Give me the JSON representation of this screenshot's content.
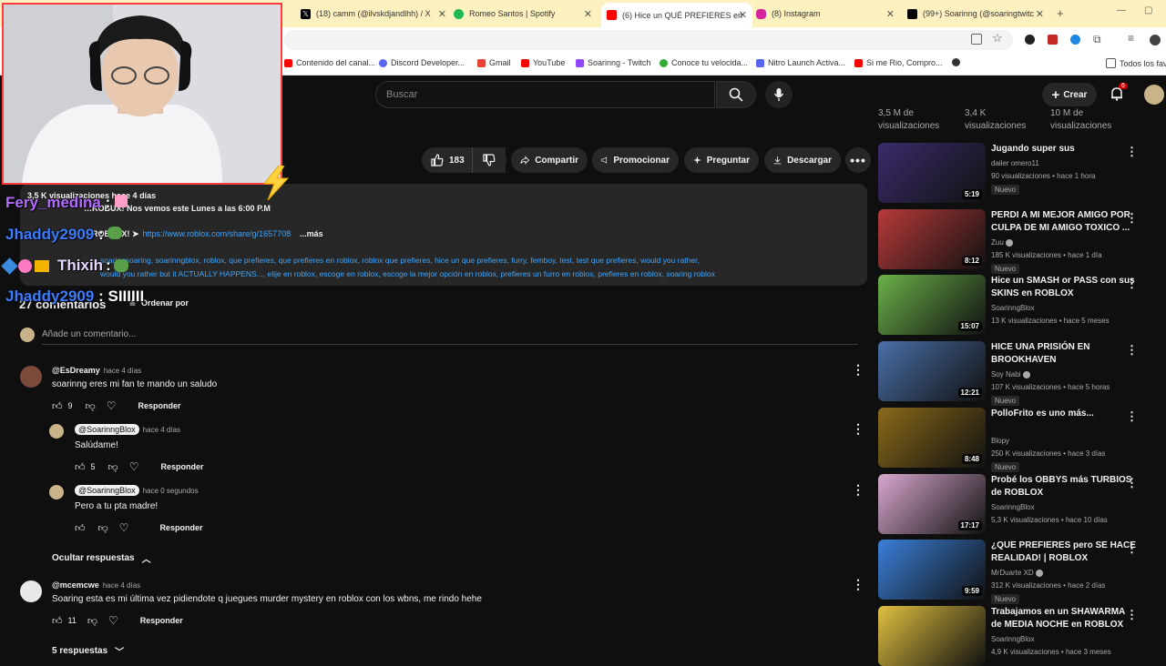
{
  "browser": {
    "tabs": [
      {
        "label": "(18) camm (@ilvskdjandlhh) / X",
        "color": "#000000",
        "icon": "x-logo-icon"
      },
      {
        "label": "Romeo Santos | Spotify",
        "color": "#1db954",
        "icon": "spotify-icon"
      },
      {
        "label": "(6) Hice un QUÉ PREFIERES en",
        "color": "#ff0000",
        "icon": "youtube-icon"
      },
      {
        "label": "(8) Instagram",
        "color": "#d6249f",
        "icon": "instagram-icon"
      },
      {
        "label": "(99+) Soarinng (@soaringtwitc",
        "color": "#000000",
        "icon": "tiktok-icon"
      }
    ],
    "bookmarks": [
      {
        "label": "Contenido del canal...",
        "color": "#ff0000"
      },
      {
        "label": "Discord Developer...",
        "color": "#5865f2"
      },
      {
        "label": "Gmail",
        "color": "#ea4335"
      },
      {
        "label": "YouTube",
        "color": "#ff0000"
      },
      {
        "label": "Soarinng - Twitch",
        "color": "#9146ff"
      },
      {
        "label": "Conoce tu velocida...",
        "color": "#33aa33"
      },
      {
        "label": "Nitro Launch Activa...",
        "color": "#5865f2"
      },
      {
        "label": "Si me Rio, Compro...",
        "color": "#ff0000"
      }
    ],
    "all_bookmarks": "Todos los fav"
  },
  "youtube": {
    "search_placeholder": "Buscar",
    "create_label": "Crear",
    "notif_count": "6",
    "top_stats": [
      "3,5 M de visualizaciones",
      "3,4 K visualizaciones",
      "10 M de visualizaciones"
    ],
    "actions": {
      "likes": "183",
      "share": "Compartir",
      "promote": "Promocionar",
      "ask": "Preguntar",
      "download": "Descargar"
    },
    "description": {
      "stats": "3,5 K visualizaciones  hace 4 días",
      "line1": "…ROBUX! Nos vemos este Lunes a las 6:00 P.M",
      "line2_prefix": "…ROBLOX! ➤",
      "link": "https://www.roblox.com/share/g/1657708",
      "more": "...más",
      "tags_line1": "soaringsoaring, soarinngblox, roblox, que prefieres, que prefieres en roblox, roblox que prefieres, hice un que prefieres, furry, femboy, test, test que prefieres, would you rather,",
      "tags_line2": "would you rather but it ACTUALLY HAPPENS..., elije en roblox, escoge en roblox, escoge la mejor opción en roblox, prefieres un furro en roblox, prefieres en roblox, soaring roblox"
    },
    "comments_header": {
      "count": "27 comentarios",
      "sort": "Ordenar por"
    },
    "add_comment": "Añade un comentario...",
    "comments": [
      {
        "author": "@EsDreamy",
        "time": "hace 4 días",
        "text": "soarinng eres mi fan te mando un saludo",
        "likes": "9",
        "reply": "Responder"
      },
      {
        "author": "@SoarinngBlox",
        "time": "hace 4 días",
        "text": "Salúdame!",
        "likes": "5",
        "reply": "Responder"
      },
      {
        "author": "@SoarinngBlox",
        "time": "hace 0 segundos",
        "text": "Pero a tu pta madre!",
        "likes": "",
        "reply": "Responder"
      },
      {
        "author": "@mcemcwe",
        "time": "hace 4 días",
        "text": "Soaring esta es mi última vez pidiendote q juegues murder mystery en roblox con los wbns, me rindo hehe",
        "likes": "11",
        "reply": "Responder"
      }
    ],
    "hide_replies": "Ocultar respuestas",
    "more_replies": "5 respuestas",
    "recommendations": [
      {
        "title": "Jugando super sus",
        "channel": "dailer omero11",
        "meta": "90 visualizaciones • hace 1 hora",
        "badge": "Nuevo",
        "duration": "5:19",
        "thumb": "#3b2b6b",
        "verified": false
      },
      {
        "title": "PERDI A MI MEJOR AMIGO POR CULPA DE MI AMIGO TOXICO ...",
        "channel": "Zuu",
        "meta": "185 K visualizaciones • hace 1 día",
        "badge": "Nuevo",
        "duration": "8:12",
        "thumb": "#b83a3a",
        "verified": true
      },
      {
        "title": "Hice un SMASH or PASS con sus SKINS en ROBLOX",
        "channel": "SoarinngBlox",
        "meta": "13 K visualizaciones • hace 5 meses",
        "badge": "",
        "duration": "15:07",
        "thumb": "#6bb04a",
        "verified": false
      },
      {
        "title": "HICE UNA PRISIÓN EN BROOKHAVEN",
        "channel": "Soy Nabi",
        "meta": "107 K visualizaciones • hace 5 horas",
        "badge": "Nuevo",
        "duration": "12:21",
        "thumb": "#4a6fa8",
        "verified": true
      },
      {
        "title": "PolloFrito es uno más...",
        "channel": "Blopy",
        "meta": "250 K visualizaciones • hace 3 días",
        "badge": "Nuevo",
        "duration": "8:48",
        "thumb": "#8a6a1a",
        "verified": false
      },
      {
        "title": "Probé los OBBYS más TURBIOS de ROBLOX",
        "channel": "SoarinngBlox",
        "meta": "5,3 K visualizaciones • hace 10 días",
        "badge": "",
        "duration": "17:17",
        "thumb": "#d9a8d0",
        "verified": false
      },
      {
        "title": "¿QUE PREFIERES pero SE HACE REALIDAD! | ROBLOX",
        "channel": "MrDuarte XD",
        "meta": "312 K visualizaciones • hace 2 días",
        "badge": "Nuevo",
        "duration": "9:59",
        "thumb": "#3a7fd9",
        "verified": true
      },
      {
        "title": "Trabajamos en un SHAWARMA de MEDIA NOCHE en ROBLOX",
        "channel": "SoarinngBlox",
        "meta": "4,9 K visualizaciones • hace 3 meses",
        "badge": "",
        "duration": "",
        "thumb": "#e0c040",
        "verified": false
      }
    ]
  },
  "overlay": {
    "chat": [
      {
        "user": "Fery_medina",
        "sep": ":",
        "msg": "",
        "color": "#b36bff"
      },
      {
        "user": "Jhaddy2909",
        "sep": ":",
        "msg": "",
        "color": "#3b7dff"
      },
      {
        "user": "Thixih",
        "sep": ":",
        "msg": "",
        "color": "#e8d8ff"
      },
      {
        "user": "Jhaddy2909",
        "sep": ":",
        "msg": "SIIIIII",
        "color": "#3b7dff"
      }
    ]
  }
}
